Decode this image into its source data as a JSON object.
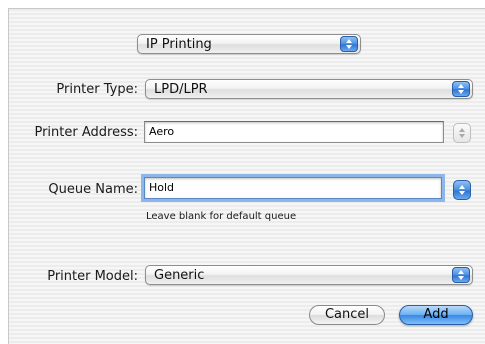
{
  "connection_popup": {
    "selected": "IP Printing"
  },
  "printer_type": {
    "label": "Printer Type:",
    "selected": "LPD/LPR"
  },
  "printer_address": {
    "label": "Printer Address:",
    "value": "Aero"
  },
  "queue_name": {
    "label": "Queue Name:",
    "value": "Hold",
    "hint": "Leave blank for default queue"
  },
  "printer_model": {
    "label": "Printer Model:",
    "selected": "Generic"
  },
  "buttons": {
    "cancel": "Cancel",
    "add": "Add"
  },
  "icons": {
    "popup_arrows": "up-down-arrows-icon",
    "stepper": "stepper-arrows-icon"
  }
}
